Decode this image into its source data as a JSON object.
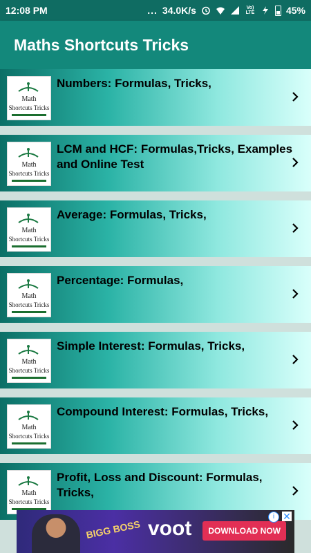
{
  "status_bar": {
    "time": "12:08 PM",
    "dots": "...",
    "speed": "34.0K/s",
    "network_label": "Vo) LTE",
    "battery": "45%",
    "icons": [
      "alarm-icon",
      "wifi-icon",
      "signal-icon",
      "volte-icon",
      "charging-icon",
      "battery-icon"
    ]
  },
  "app_bar": {
    "title": "Maths Shortcuts Tricks"
  },
  "list": {
    "thumb_text_1": "Math",
    "thumb_text_2": "Shortcuts Tricks",
    "items": [
      {
        "title": "Numbers: Formulas, Tricks,"
      },
      {
        "title": "LCM and HCF: Formulas,Tricks, Examples and Online Test"
      },
      {
        "title": "Average: Formulas, Tricks,"
      },
      {
        "title": "Percentage: Formulas,"
      },
      {
        "title": "Simple Interest: Formulas, Tricks,"
      },
      {
        "title": "Compound Interest: Formulas, Tricks,"
      },
      {
        "title": "Profit, Loss and Discount: Formulas, Tricks,"
      }
    ]
  },
  "ad": {
    "show_name": "BIGG BOSS",
    "brand": "voot",
    "cta": "DOWNLOAD NOW",
    "info_icon": "i",
    "close_icon": "✕"
  }
}
